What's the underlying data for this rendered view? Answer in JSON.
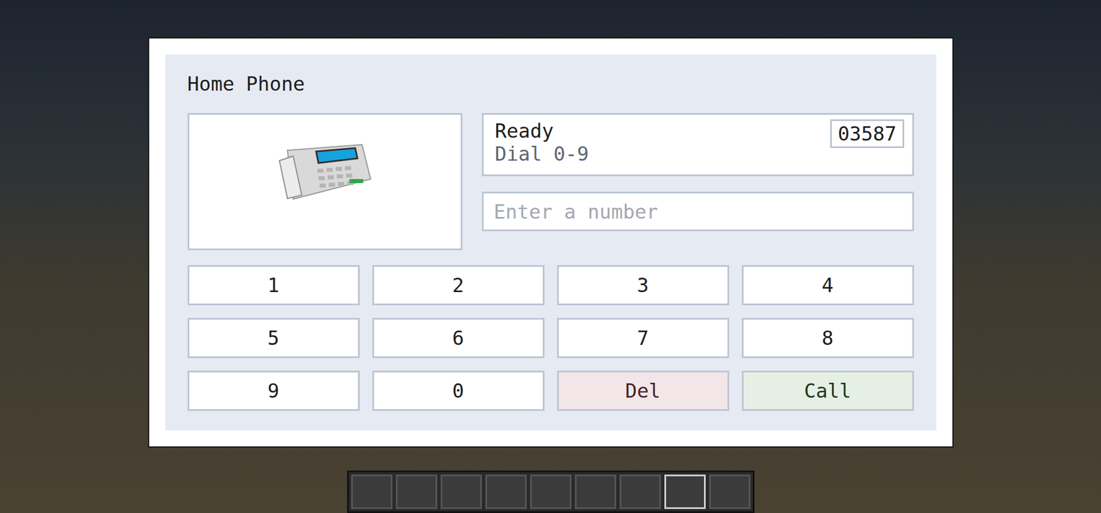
{
  "window": {
    "title": "Home Phone"
  },
  "status": {
    "state": "Ready",
    "hint": "Dial 0-9",
    "number": "03587"
  },
  "input": {
    "placeholder": "Enter a number",
    "value": ""
  },
  "keys": [
    {
      "label": "1",
      "kind": "digit"
    },
    {
      "label": "2",
      "kind": "digit"
    },
    {
      "label": "3",
      "kind": "digit"
    },
    {
      "label": "4",
      "kind": "digit"
    },
    {
      "label": "5",
      "kind": "digit"
    },
    {
      "label": "6",
      "kind": "digit"
    },
    {
      "label": "7",
      "kind": "digit"
    },
    {
      "label": "8",
      "kind": "digit"
    },
    {
      "label": "9",
      "kind": "digit"
    },
    {
      "label": "0",
      "kind": "digit"
    },
    {
      "label": "Del",
      "kind": "delete"
    },
    {
      "label": "Call",
      "kind": "call"
    }
  ],
  "hotbar": [
    {
      "selected": false
    },
    {
      "selected": false
    },
    {
      "selected": false
    },
    {
      "selected": false
    },
    {
      "selected": false
    },
    {
      "selected": false
    },
    {
      "selected": false
    },
    {
      "selected": true
    },
    {
      "selected": false
    }
  ]
}
